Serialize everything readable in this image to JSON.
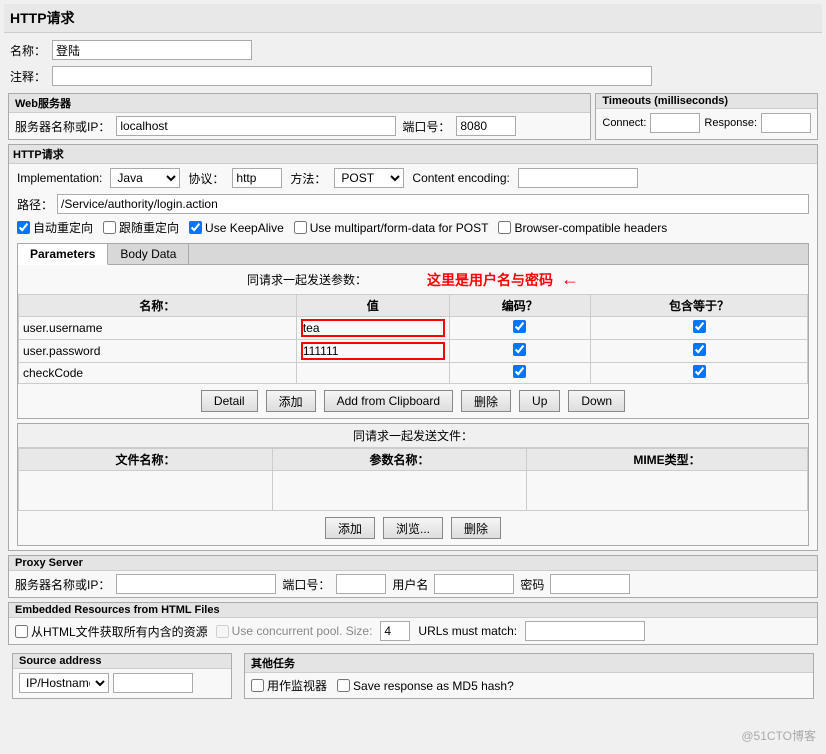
{
  "page": {
    "title": "HTTP请求"
  },
  "name_field": {
    "label": "名称：",
    "value": "登陆"
  },
  "comment_field": {
    "label": "注释：",
    "value": ""
  },
  "web_server": {
    "section_title": "Web服务器",
    "server_label": "服务器名称或IP：",
    "server_value": "localhost",
    "port_label": "端口号：",
    "port_value": "8080"
  },
  "timeouts": {
    "section_title": "Timeouts (milliseconds)",
    "connect_label": "Connect:",
    "connect_value": "",
    "response_label": "Response:",
    "response_value": ""
  },
  "http_request": {
    "section_title": "HTTP请求",
    "implementation_label": "Implementation:",
    "implementation_value": "Java",
    "protocol_label": "协议：",
    "protocol_value": "http",
    "method_label": "方法：",
    "method_value": "POST",
    "encoding_label": "Content encoding:",
    "encoding_value": "",
    "path_label": "路径：",
    "path_value": "/Service/authority/login.action",
    "checkboxes": [
      {
        "label": "自动重定向",
        "checked": true
      },
      {
        "label": "跟随重定向",
        "checked": false
      },
      {
        "label": "Use KeepAlive",
        "checked": true
      },
      {
        "label": "Use multipart/form-data for POST",
        "checked": false
      },
      {
        "label": "Browser-compatible headers",
        "checked": false
      }
    ]
  },
  "tabs": [
    {
      "label": "Parameters",
      "active": true
    },
    {
      "label": "Body Data",
      "active": false
    }
  ],
  "params": {
    "note": "同请求一起发送参数：",
    "annotation": "这里是用户名与密码",
    "header_name": "名称：",
    "header_value": "值",
    "header_encoded": "编码？",
    "header_include": "包含等于？",
    "rows": [
      {
        "name": "user.username",
        "value": "tea",
        "encoded": true,
        "include": true
      },
      {
        "name": "user.password",
        "value": "111111",
        "encoded": true,
        "include": true
      },
      {
        "name": "checkCode",
        "value": "",
        "encoded": true,
        "include": true
      }
    ]
  },
  "param_buttons": {
    "detail": "Detail",
    "add": "添加",
    "add_clipboard": "Add from Clipboard",
    "delete": "删除",
    "up": "Up",
    "down": "Down"
  },
  "files": {
    "note": "同请求一起发送文件：",
    "header_filename": "文件名称：",
    "header_paramname": "参数名称：",
    "header_mimetype": "MIME类型："
  },
  "file_buttons": {
    "add": "添加",
    "browse": "浏览...",
    "delete": "删除"
  },
  "proxy": {
    "section_title": "Proxy Server",
    "server_label": "服务器名称或IP：",
    "server_value": "",
    "port_label": "端口号：",
    "port_value": "",
    "user_label": "用户名",
    "user_value": "",
    "pass_label": "密码",
    "pass_value": ""
  },
  "embedded": {
    "section_title": "Embedded Resources from HTML Files",
    "checkbox1": "从HTML文件获取所有内含的资源",
    "checkbox1_checked": false,
    "checkbox2": "Use concurrent pool. Size:",
    "checkbox2_checked": false,
    "pool_size": "4",
    "urls_label": "URLs must match:",
    "urls_value": ""
  },
  "source": {
    "section_title": "Source address",
    "dropdown_value": "IP/Hostname"
  },
  "other": {
    "section_title": "其他任务",
    "checkbox1": "用作监视器",
    "checkbox1_checked": false,
    "checkbox2": "Save response as MD5 hash?",
    "checkbox2_checked": false
  },
  "watermark": "@51CTO博客"
}
